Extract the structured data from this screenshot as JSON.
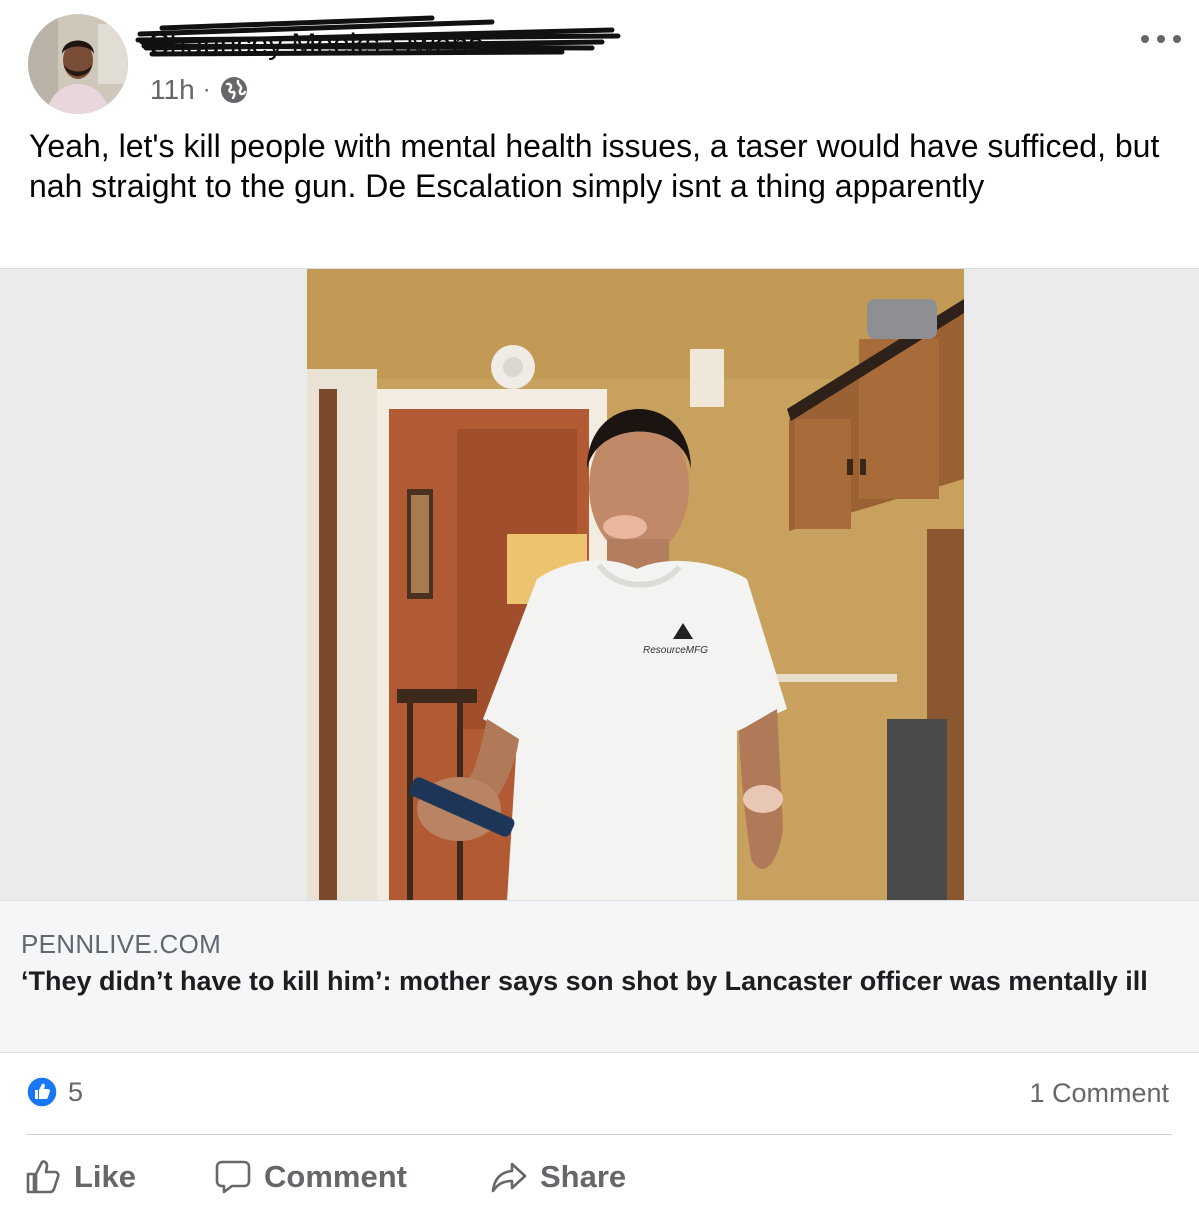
{
  "post": {
    "author_name": "Chauncey Meeks-Owens",
    "timestamp": "11h",
    "separator": "·",
    "audience_icon": "globe-icon",
    "more_icon": "more-horizontal-icon",
    "text": "Yeah, let's kill people with mental health issues, a taser would have sufficed, but nah straight to the gun. De Escalation simply isnt a thing apparently"
  },
  "photo": {
    "shirt_logo_text": "ResourceMFG"
  },
  "link_preview": {
    "domain": "PENNLIVE.COM",
    "title": "‘They didn’t have to kill him’: mother says son shot by Lancaster officer was mentally ill"
  },
  "reactions": {
    "icon": "like-reaction-icon",
    "count": "5",
    "comments": "1 Comment"
  },
  "actions": {
    "like": "Like",
    "comment": "Comment",
    "share": "Share"
  },
  "colors": {
    "like_blue": "#1877f2",
    "muted_text": "#65676b",
    "link_background": "#f5f6f8"
  }
}
